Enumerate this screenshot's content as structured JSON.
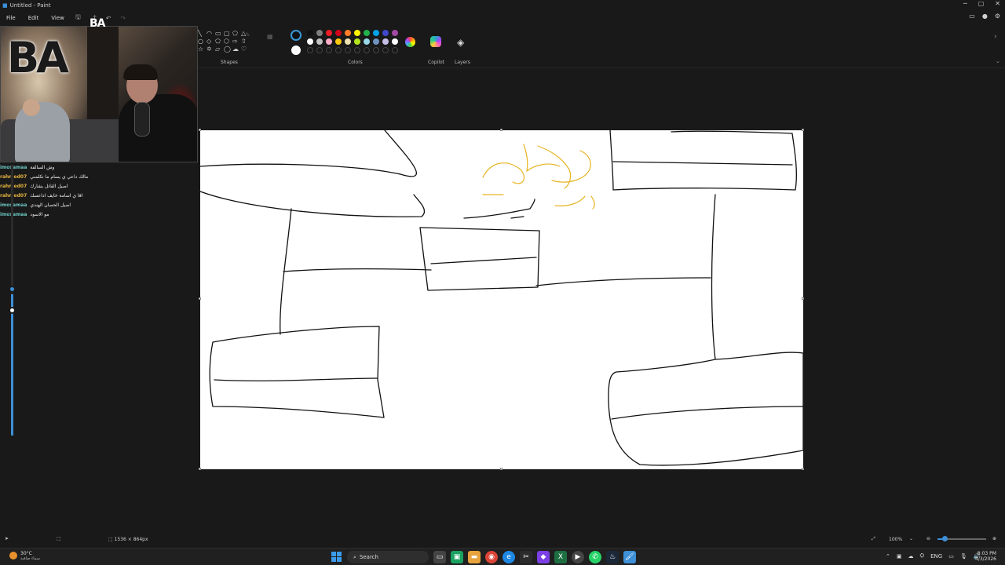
{
  "window": {
    "title": "Untitled - Paint",
    "controls": {
      "minimize": "─",
      "maximize": "▢",
      "close": "✕"
    }
  },
  "menu": {
    "file": "File",
    "edit": "Edit",
    "view": "View"
  },
  "ribbon": {
    "shapes_label": "Shapes",
    "colors_label": "Colors",
    "copilot_label": "Copilot",
    "layers_label": "Layers",
    "palette": [
      "#111111",
      "#7f7f7f",
      "#ed1c24",
      "#d0021b",
      "#ff7f27",
      "#fff200",
      "#22b14c",
      "#00a2e8",
      "#3f48cc",
      "#a349a4",
      "#ffffff",
      "#c3c3c3",
      "#ffaec9",
      "#ffc90e",
      "#efe4b0",
      "#b5e61d",
      "#99d9ea",
      "#7092be",
      "#c8bfe7",
      "#ffffff"
    ],
    "active_color": "#111111",
    "secondary_color": "#ffffff"
  },
  "overlay": {
    "logo": "BA",
    "stream_logo_small": "BA"
  },
  "chat": [
    {
      "user": "imosamaa",
      "msg": "وش السالفة",
      "teal": true
    },
    {
      "user": "rahmed07",
      "msg": "مالك داعي ي يسام ما تكلمني",
      "teal": false
    },
    {
      "user": "rahmed07",
      "msg": "اصيل القاتل يشارك",
      "teal": false
    },
    {
      "user": "rahmed07",
      "msg": "اقا ي اسامة خايف اداعسك",
      "teal": false
    },
    {
      "user": "imosamaa",
      "msg": "اصيل الحصان الهندي",
      "teal": true
    },
    {
      "user": "imosamaa",
      "msg": "مو الاسود",
      "teal": true
    }
  ],
  "status": {
    "dimensions": "1536 × 864px",
    "zoom": "100%",
    "zoom_fraction": 0.16
  },
  "taskbar": {
    "weather_temp": "30°C",
    "weather_desc": "سماء صافية",
    "search_placeholder": "Search",
    "language": "ENG",
    "time": "8:03 PM",
    "date": "4/3/2026"
  }
}
